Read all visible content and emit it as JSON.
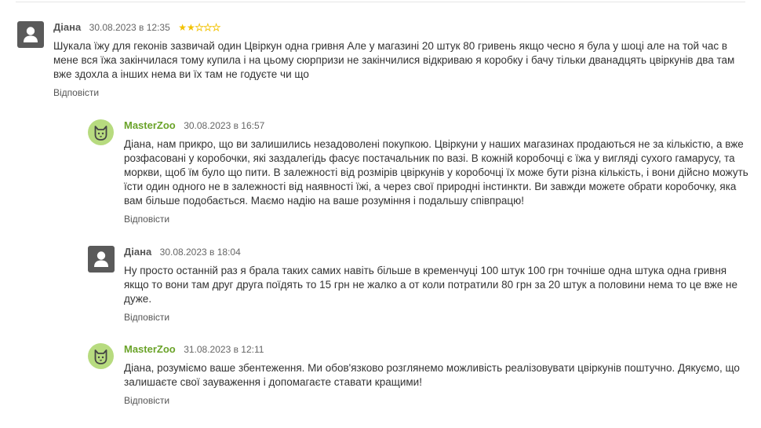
{
  "comments": [
    {
      "author": "Діана",
      "date": "30.08.2023 в 12:35",
      "rating": 2,
      "rating_max": 5,
      "text": "Шукала їжу для геконів зазвичай один Цвіркун одна гривня Але у магазині 20 штук 80 гривень якщо чесно я була у шоці але на той час в мене вся їжа закінчилася тому купила і на цьому сюрпризи не закінчилися відкриваю я коробку і бачу тільки дванадцять цвіркунів два там вже здохла а інших нема ви їх там не годуєте чи що",
      "reply_label": "Відповісти"
    },
    {
      "author": "MasterZoo",
      "date": "30.08.2023 в 16:57",
      "text": "Діана, нам прикро, що ви залишились незадоволені покупкою. Цвіркуни у наших магазинах продаються не за кількістю, а вже розфасовані у коробочки, які заздалегідь фасує постачальник по вазі. В кожній коробочці є їжа у вигляді сухого гамарусу, та моркви, щоб їм було що пити. В залежності від розмірів цвіркунів у коробочці їх може бути різна кількість, і вони дійсно можуть їсти один одного не в залежності від наявності їжі, а через свої природні інстинкти. Ви завжди можете обрати коробочку, яка вам більше подобається. Маємо надію на ваше розуміння і подальшу співпрацю!",
      "reply_label": "Відповісти"
    },
    {
      "author": "Діана",
      "date": "30.08.2023 в 18:04",
      "text": "Ну просто останній раз я брала таких самих навіть більше в кременчуці 100 штук 100 грн точніше одна штука одна гривня якщо то вони там друг друга поїдять то 15 грн не жалко а от коли потратили 80 грн за 20 штук а половини нема то це вже не дуже.",
      "reply_label": "Відповісти"
    },
    {
      "author": "MasterZoo",
      "date": "31.08.2023 в 12:11",
      "text": "Діана, розуміємо ваше збентеження. Ми обов'язково розглянемо можливість реалізовувати цвіркунів поштучно. Дякуємо, що залишаєте свої зауваження і допомагаєте ставати кращими!",
      "reply_label": "Відповісти"
    }
  ],
  "icons": {
    "user_avatar": "user-silhouette-icon",
    "brand_avatar": "cat-face-icon",
    "star": "star-icon"
  },
  "colors": {
    "brand_author": "#6aa329",
    "brand_avatar_bg": "#b7db7f",
    "user_avatar_bg": "#5a5a5a",
    "star": "#f2c200"
  }
}
